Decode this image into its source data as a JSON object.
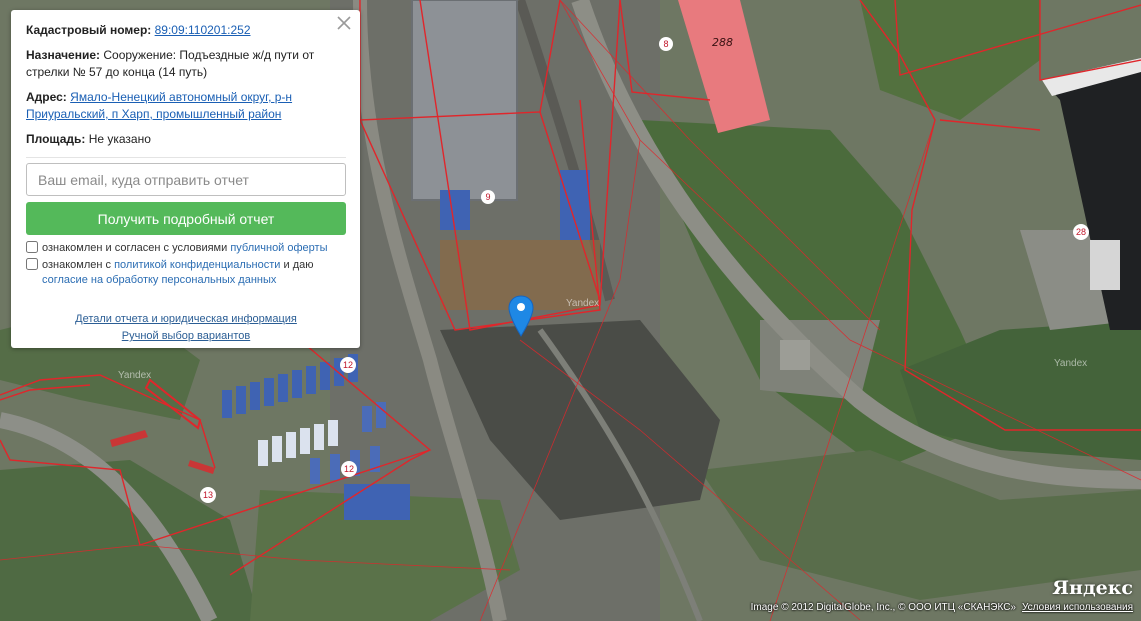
{
  "panel": {
    "cadastral_label": "Кадастровый номер:",
    "cadastral_value": "89:09:110201:252",
    "purpose_label": "Назначение:",
    "purpose_value": "Сооружение: Подъездные ж/д пути от стрелки № 57 до конца (14 путь)",
    "address_label": "Адрес:",
    "address_line1": "Ямало-Ненецкий автономный округ, р-н",
    "address_line2": "Приуральский, п Харп, промышленный район",
    "area_label": "Площадь:",
    "area_value": "Не указано",
    "email_placeholder": "Ваш email, куда отправить отчет",
    "submit_label": "Получить подробный отчет",
    "agree1_text": "ознакомлен и согласен с условиями ",
    "agree1_link": "публичной оферты",
    "agree2_text1": "ознакомлен с ",
    "agree2_link1": "политикой конфиденциальности",
    "agree2_text2": " и даю",
    "agree2_link2": "согласие на обработку персональных данных",
    "details_link": "Детали отчета и юридическая информация",
    "manual_link": "Ручной выбор вариантов",
    "close_icon": "close-icon"
  },
  "map": {
    "building_labels": [
      "288",
      "8",
      "9",
      "28",
      "12",
      "12",
      "13"
    ],
    "watermark": "Yandex",
    "logo": "Яндекс",
    "attribution": "Image © 2012 DigitalGlobe, Inc., © ООО ИТЦ «СКАНЭКС»",
    "terms_link": "Условия использования",
    "marker_icon": "map-pin-icon",
    "marker_color": "#1e88e5",
    "boundary_color": "#e0262b"
  }
}
